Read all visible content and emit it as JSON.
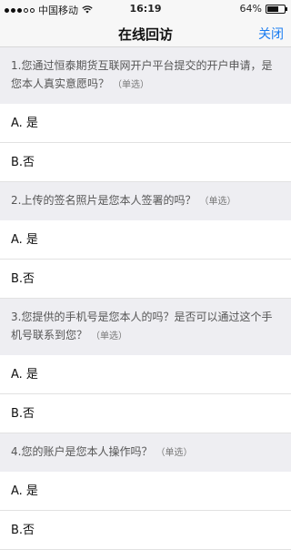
{
  "status_bar": {
    "carrier": "中国移动",
    "time": "16:19",
    "battery_text": "64%",
    "battery_level": 0.64
  },
  "nav": {
    "title": "在线回访",
    "close_label": "关闭"
  },
  "single_choice_tag": "（单选）",
  "questions": [
    {
      "text": "1.您通过恒泰期货互联网开户平台提交的开户申请，是您本人真实意愿吗？",
      "options": [
        "A.  是",
        "B.否"
      ]
    },
    {
      "text": "2.上传的签名照片是您本人签署的吗？",
      "options": [
        "A.  是",
        "B.否"
      ]
    },
    {
      "text": "3.您提供的手机号是您本人的吗？是否可以通过这个手机号联系到您？",
      "options": [
        "A.  是",
        "B.否"
      ]
    },
    {
      "text": "4.您的账户是您本人操作吗？",
      "options": [
        "A.  是",
        "B.否"
      ]
    }
  ]
}
